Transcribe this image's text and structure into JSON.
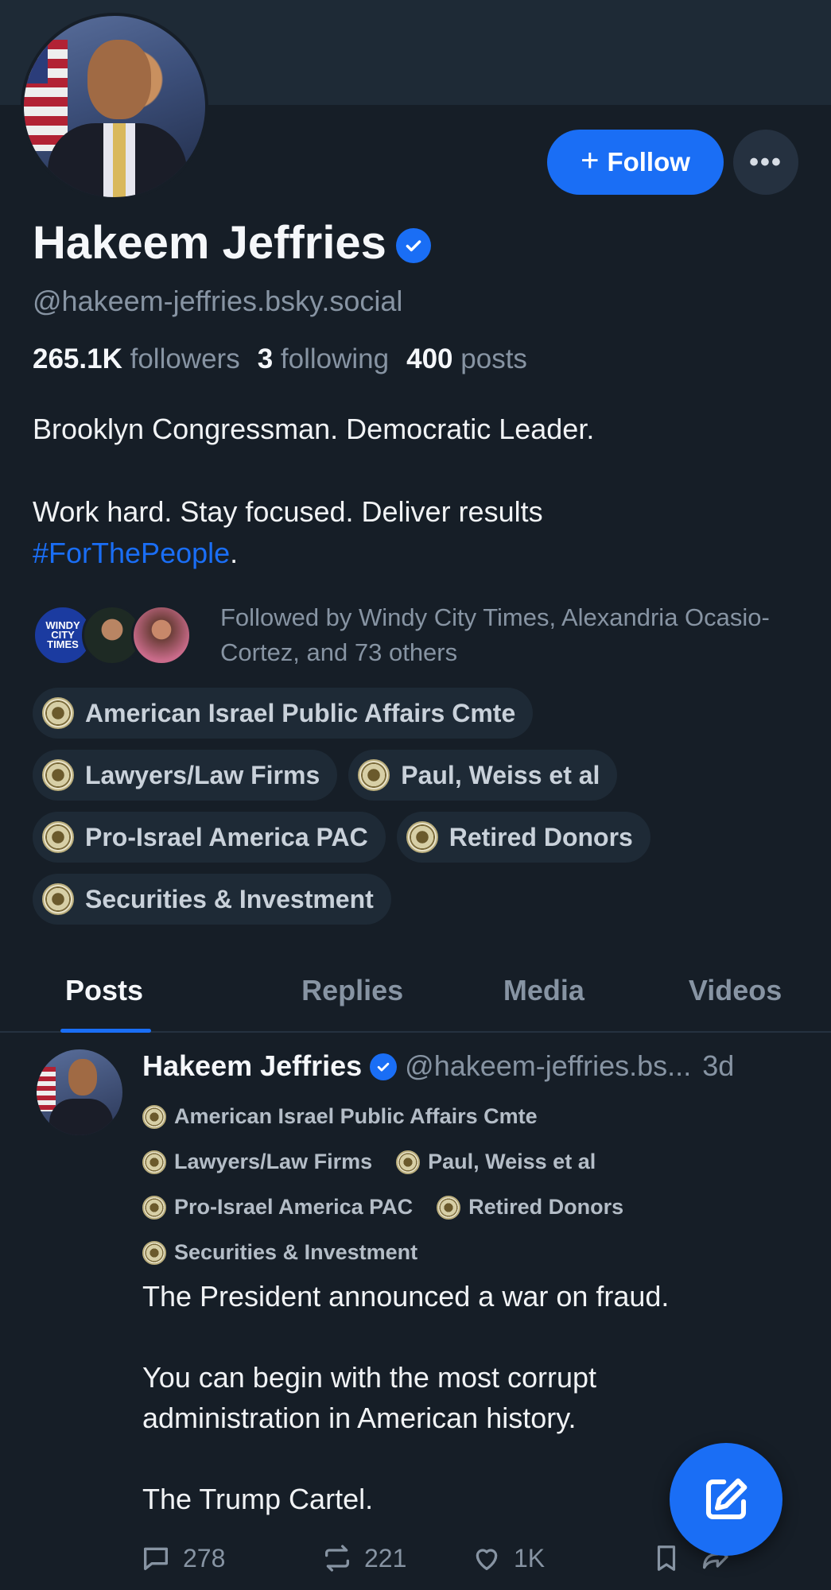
{
  "profile": {
    "name": "Hakeem Jeffries",
    "handle": "@hakeem-jeffries.bsky.social",
    "follow_label": "Follow",
    "more_label": "•••",
    "stats": {
      "followers_count": "265.1K",
      "followers_label": "followers",
      "following_count": "3",
      "following_label": "following",
      "posts_count": "400",
      "posts_label": "posts"
    },
    "bio_line1": "Brooklyn Congressman. Democratic Leader.",
    "bio_line2": "Work hard. Stay focused. Deliver results",
    "bio_hashtag": "#ForThePeople",
    "bio_end": ".",
    "followed_by": "Followed by Windy City Times, Alexandria Ocasio-Cortez, and 73 others",
    "followed_avatar1_text": "WINDY CITY TIMES",
    "labels": [
      "American Israel Public Affairs Cmte",
      "Lawyers/Law Firms",
      "Paul, Weiss et al",
      "Pro-Israel America PAC",
      "Retired Donors",
      "Securities & Investment"
    ]
  },
  "tabs": [
    "Posts",
    "Replies",
    "Media",
    "Videos"
  ],
  "active_tab": "Posts",
  "post": {
    "author": "Hakeem Jeffries",
    "handle": "@hakeem-jeffries.bs...",
    "time": "3d",
    "labels": [
      "American Israel Public Affairs Cmte",
      "Lawyers/Law Firms",
      "Paul, Weiss et al",
      "Pro-Israel America PAC",
      "Retired Donors",
      "Securities & Investment"
    ],
    "text_p1": "The President announced a war on fraud.",
    "text_p2": "You can begin with the most corrupt administration in American history.",
    "text_p3": "The Trump Cartel.",
    "reply_count": "278",
    "repost_count": "221",
    "like_count": "1K"
  },
  "colors": {
    "background": "#161e27",
    "accent": "#1a6ef5",
    "muted_text": "#8794a3"
  }
}
